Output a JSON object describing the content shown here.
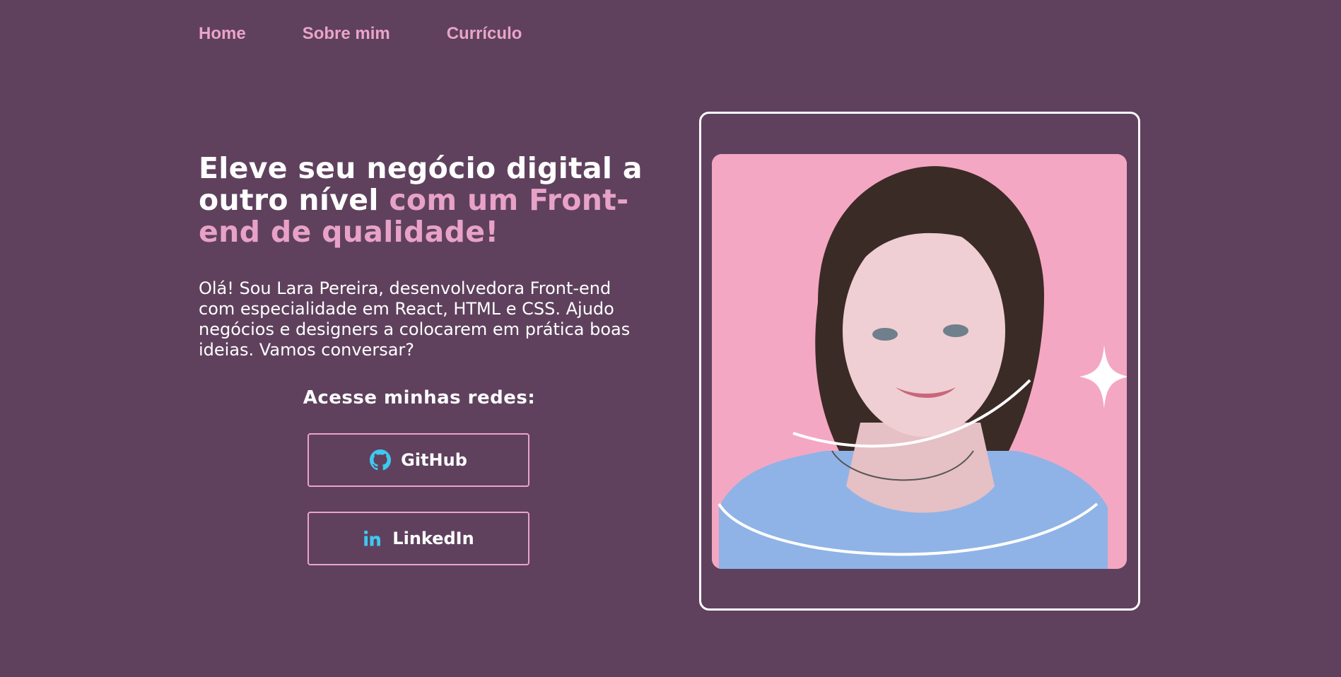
{
  "nav": {
    "items": [
      {
        "label": "Home"
      },
      {
        "label": "Sobre mim"
      },
      {
        "label": "Currículo"
      }
    ]
  },
  "hero": {
    "headline_white": "Eleve seu negócio digital a outro nível",
    "headline_accent": "com um Front-end de qualidade!",
    "intro": "Olá! Sou Lara Pereira, desenvolvedora Front-end com especialidade em React, HTML e CSS. Ajudo negócios e designers a colocarem em prática boas ideias. Vamos conversar?",
    "social_title": "Acesse minhas redes:",
    "buttons": [
      {
        "label": "GitHub",
        "icon": "github-icon"
      },
      {
        "label": "LinkedIn",
        "icon": "linkedin-icon"
      }
    ]
  },
  "colors": {
    "background": "#5f415e",
    "accent_pink": "#e8a2c7",
    "photo_background": "#f4a7c2",
    "icon_blue": "#3fc8f0"
  }
}
